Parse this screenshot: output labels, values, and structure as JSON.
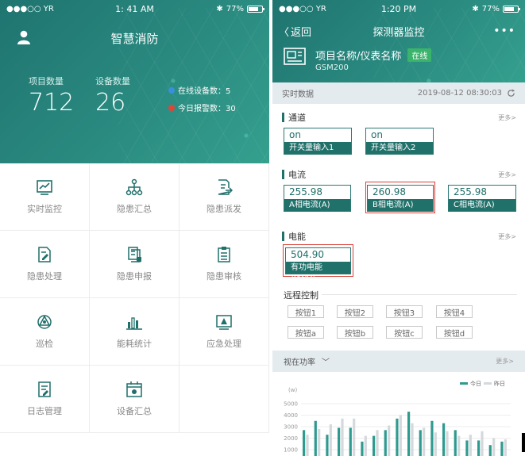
{
  "left_screen": {
    "status": {
      "carrier": "●●●○○ YR",
      "time": "1: 41 AM",
      "battery": "77%",
      "battery_level": 0.77
    },
    "title": "智慧消防",
    "stats": {
      "project_label": "项目数量",
      "project_count": "712",
      "device_label": "设备数量",
      "device_count": "26",
      "online_devices": "在线设备数：5",
      "today_alarms": "今日报警数：30"
    },
    "menu": [
      {
        "label": "实时监控",
        "icon": "monitor-chart-icon"
      },
      {
        "label": "隐患汇总",
        "icon": "hierarchy-icon"
      },
      {
        "label": "隐患派发",
        "icon": "document-send-icon"
      },
      {
        "label": "隐患处理",
        "icon": "document-edit-icon"
      },
      {
        "label": "隐患申报",
        "icon": "document-report-icon"
      },
      {
        "label": "隐患审核",
        "icon": "clipboard-list-icon"
      },
      {
        "label": "巡检",
        "icon": "patrol-icon"
      },
      {
        "label": "能耗统计",
        "icon": "bar-stats-icon"
      },
      {
        "label": "应急处理",
        "icon": "alert-screen-icon"
      },
      {
        "label": "日志管理",
        "icon": "log-document-icon"
      },
      {
        "label": "设备汇总",
        "icon": "device-summary-icon"
      }
    ],
    "colors": {
      "header": "#23756f",
      "accent": "#1f6f6a",
      "online_dot": "#3a8fdc",
      "alarm_dot": "#e0453a"
    }
  },
  "right_screen": {
    "status": {
      "carrier": "●●●○○ YR",
      "time": "1:20 PM",
      "battery": "77%",
      "battery_level": 0.77
    },
    "nav": {
      "back": "返回",
      "title": "探测器监控",
      "more": "•••"
    },
    "device": {
      "name": "项目名称/仪表名称",
      "status": "在线",
      "model": "GSM200"
    },
    "realtime": {
      "label": "实时数据",
      "timestamp": "2019-08-12 08:30:03"
    },
    "sections": {
      "channel": {
        "title": "通道",
        "more": "更多>",
        "items": [
          {
            "value": "on",
            "name": "开关量输入1"
          },
          {
            "value": "on",
            "name": "开关量输入2"
          }
        ]
      },
      "current": {
        "title": "电流",
        "more": "更多>",
        "items": [
          {
            "value": "255.98",
            "name": "A相电流(A)"
          },
          {
            "value": "260.98",
            "name": "B相电流(A)"
          },
          {
            "value": "255.98",
            "name": "C相电流(A)"
          }
        ]
      },
      "energy": {
        "title": "电能",
        "more": "更多>",
        "items": [
          {
            "value": "504.90",
            "name": "有功电能(KWH)"
          }
        ]
      }
    },
    "remote": {
      "title": "远程控制",
      "buttons": [
        "按钮1",
        "按钮2",
        "按钮3",
        "按钮4",
        "按钮a",
        "按钮b",
        "按钮c",
        "按钮d"
      ]
    },
    "power_header": {
      "label": "视在功率",
      "more": "更多>"
    }
  },
  "chart_data": {
    "type": "bar",
    "ylabel": "(w)",
    "yticks": [
      1000,
      2000,
      3000,
      4000,
      5000
    ],
    "ylim": [
      0,
      5500
    ],
    "legend": [
      "今日",
      "昨日"
    ],
    "legend_position": "top-right",
    "series": [
      {
        "name": "今日",
        "color": "#2f9a8f",
        "values": [
          2700,
          3500,
          2300,
          2900,
          2900,
          1700,
          2200,
          2700,
          3700,
          4300,
          2700,
          3500,
          3300,
          2700,
          1800,
          1800,
          1400,
          1700
        ]
      },
      {
        "name": "昨日",
        "color": "#d4d9dd",
        "values": [
          2300,
          2800,
          3200,
          3700,
          3700,
          2200,
          2700,
          3100,
          4000,
          3300,
          2900,
          2500,
          2600,
          2200,
          2300,
          2600,
          2000,
          1900
        ]
      }
    ]
  }
}
